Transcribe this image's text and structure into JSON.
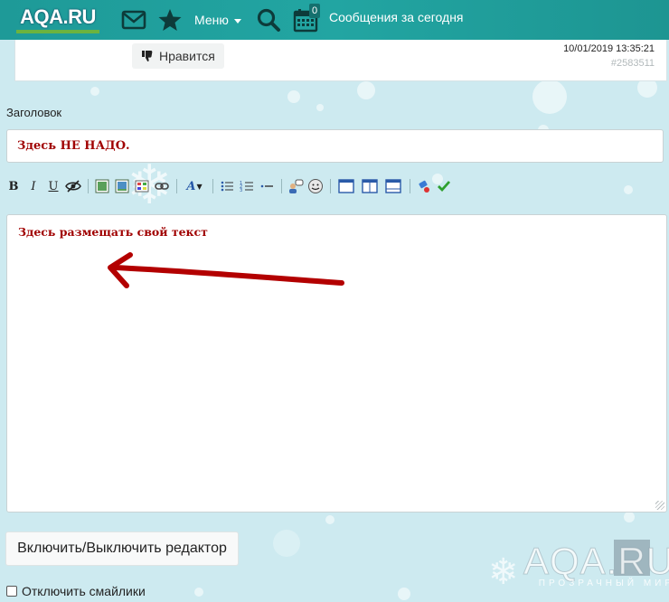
{
  "nav": {
    "logo_text": "AQA.RU",
    "menu_label": "Меню",
    "calendar_badge": "0",
    "today_label": "Сообщения за сегодня"
  },
  "post": {
    "like_label": "Нравится",
    "date": "10/01/2019 13:35:21",
    "number": "#2583511"
  },
  "form": {
    "title_label": "Заголовок",
    "title_value": "Здесь НЕ НАДО.",
    "editor_text": "Здесь размещать свой текст",
    "toggle_editor_label": "Включить/Выключить редактор",
    "disable_smileys_label": "Отключить смайлики"
  },
  "toolbar": {
    "bold": "B",
    "italic": "I",
    "underline": "U",
    "font_color": "A"
  },
  "watermark": {
    "main": "AQA.RU",
    "sub": "ПРОЗРАЧНЫЙ МИР"
  },
  "colors": {
    "nav_bg": "#1e9a98",
    "title_text": "#a00000",
    "arrow": "#b30000",
    "page_bg": "#cdeaf0"
  }
}
